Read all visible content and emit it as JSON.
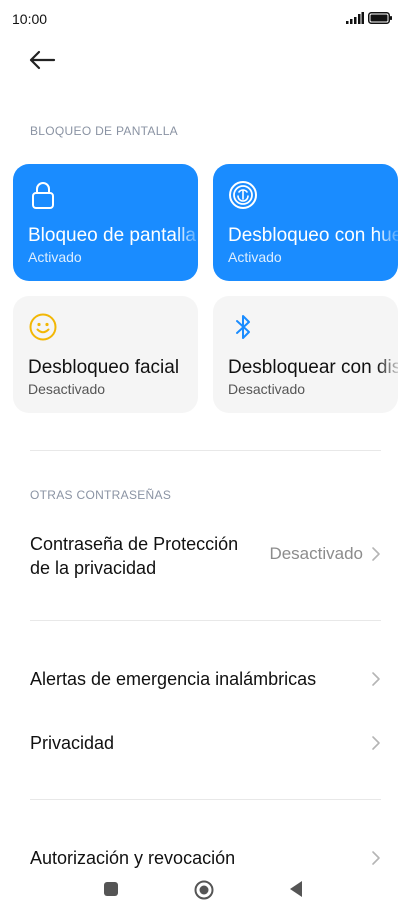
{
  "status_bar": {
    "time": "10:00"
  },
  "header": {
    "back_icon": "back-arrow-icon"
  },
  "section_lock": {
    "label": "BLOQUEO DE PANTALLA",
    "cards": [
      {
        "title": "Bloqueo de pantalla",
        "status": "Activado",
        "icon": "lock-icon",
        "active": true
      },
      {
        "title": "Desbloqueo con huella",
        "status": "Activado",
        "icon": "fingerprint-icon",
        "active": true
      },
      {
        "title": "Desbloqueo facial",
        "status": "Desactivado",
        "icon": "face-icon",
        "active": false
      },
      {
        "title": "Desbloquear con dispositivo",
        "status": "Desactivado",
        "icon": "bluetooth-icon",
        "active": false
      }
    ]
  },
  "section_other": {
    "label": "OTRAS CONTRASEÑAS",
    "privacy_password": {
      "label_line1": "Contraseña de Protección",
      "label_line2": "de la privacidad",
      "value": "Desactivado"
    }
  },
  "rows": [
    {
      "label": "Alertas de emergencia inalámbricas"
    },
    {
      "label": "Privacidad"
    },
    {
      "label": "Autorización y revocación"
    }
  ],
  "colors": {
    "accent": "#1a8cff",
    "card_inactive": "#f5f5f5",
    "face_icon": "#f2b705",
    "section_label": "#8a93a3"
  }
}
